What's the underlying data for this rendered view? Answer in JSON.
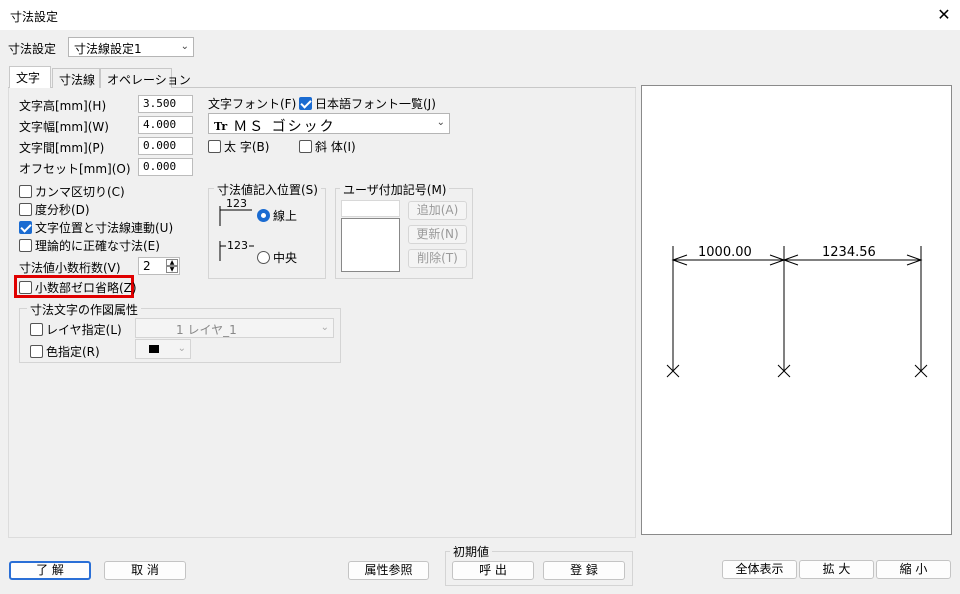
{
  "window": {
    "title": "寸法設定",
    "close_glyph": "✕"
  },
  "setting": {
    "label": "寸法設定",
    "value": "寸法線設定1"
  },
  "tabs": [
    {
      "label": "文字"
    },
    {
      "label": "寸法線"
    },
    {
      "label": "オペレーション"
    }
  ],
  "fields": {
    "height": {
      "label": "文字高[mm](H)",
      "value": "3.500"
    },
    "width": {
      "label": "文字幅[mm](W)",
      "value": "4.000"
    },
    "spacing": {
      "label": "文字間[mm](P)",
      "value": "0.000"
    },
    "offset": {
      "label": "オフセット[mm](O)",
      "value": "0.000"
    }
  },
  "font": {
    "label": "文字フォント(F)",
    "jp_font_list": "日本語フォント一覧(J)",
    "value": "ＭＳ ゴシック",
    "icon_text": "Tr",
    "bold": "太 字(B)",
    "italic": "斜 体(I)"
  },
  "options": {
    "comma": "カンマ区切り(C)",
    "dms": "度分秒(D)",
    "link": "文字位置と寸法線連動(U)",
    "exact": "理論的に正確な寸法(E)",
    "zero_omit": "小数部ゼロ省略(Z)"
  },
  "decimals": {
    "label": "寸法値小数桁数(V)",
    "value": "2"
  },
  "position_group": {
    "title": "寸法値記入位置(S)",
    "sample": "123",
    "on_line": "線上",
    "center": "中央"
  },
  "symbol_group": {
    "title": "ユーザ付加記号(M)",
    "add": "追加(A)",
    "update": "更新(N)",
    "delete": "削除(T)"
  },
  "draw_attr": {
    "title": "寸法文字の作図属性",
    "layer_label": "レイヤ指定(L)",
    "layer_value": "1 レイヤ_1",
    "color_label": "色指定(R)",
    "color_swatch": "#000000"
  },
  "buttons": {
    "ok": "了 解",
    "cancel": "取 消",
    "attr_ref": "属性参照",
    "defaults_title": "初期値",
    "recall": "呼 出",
    "register": "登 録",
    "fit": "全体表示",
    "zoom_in": "拡 大",
    "zoom_out": "縮 小"
  },
  "preview": {
    "dim1": "1000.00",
    "dim2": "1234.56"
  }
}
